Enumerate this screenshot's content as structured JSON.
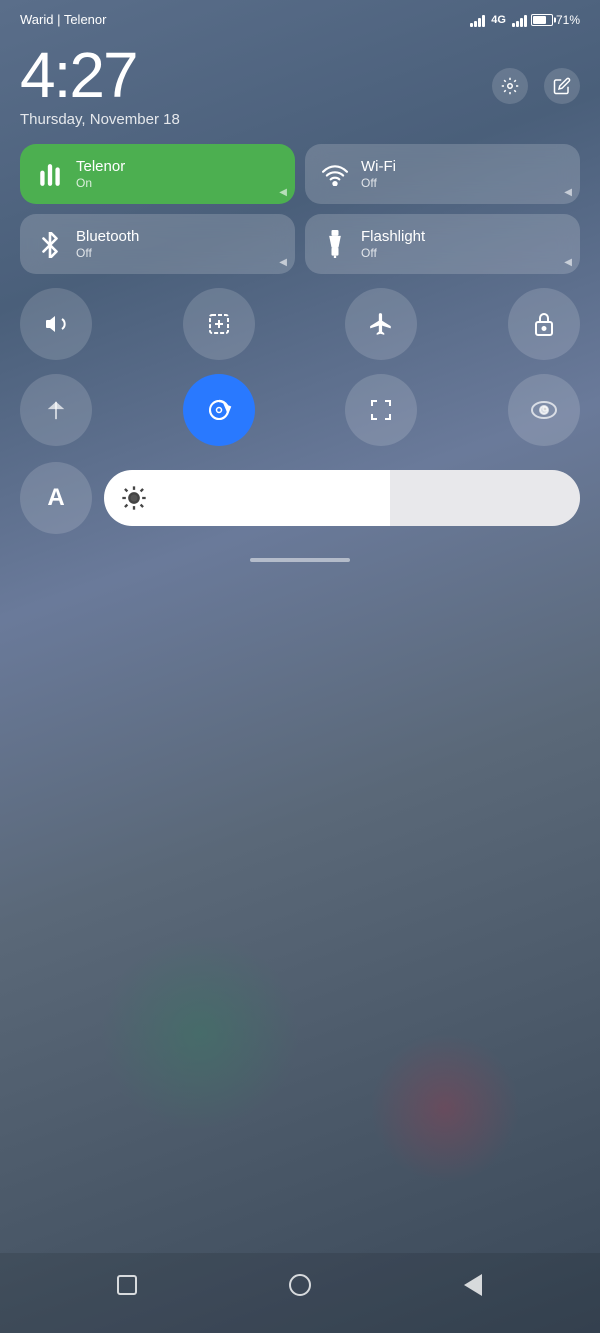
{
  "status_bar": {
    "carrier": "Warid | Telenor",
    "network": "4G",
    "battery_percent": "71%"
  },
  "clock": {
    "time": "4:27",
    "date": "Thursday, November 18"
  },
  "tiles": [
    {
      "id": "telenor",
      "name": "Telenor",
      "status": "On",
      "active": true,
      "icon": "signal"
    },
    {
      "id": "wifi",
      "name": "Wi-Fi",
      "status": "Off",
      "active": false,
      "icon": "wifi"
    },
    {
      "id": "bluetooth",
      "name": "Bluetooth",
      "status": "Off",
      "active": false,
      "icon": "bluetooth"
    },
    {
      "id": "flashlight",
      "name": "Flashlight",
      "status": "Off",
      "active": false,
      "icon": "flashlight"
    }
  ],
  "icon_circles_row1": [
    {
      "id": "bell",
      "label": "Sound",
      "icon": "🔔",
      "active": false
    },
    {
      "id": "screenshot",
      "label": "Screenshot",
      "icon": "✂",
      "active": false
    },
    {
      "id": "airplane",
      "label": "Airplane Mode",
      "icon": "✈",
      "active": false
    },
    {
      "id": "lock",
      "label": "Lock",
      "icon": "🔒",
      "active": false
    }
  ],
  "icon_circles_row2": [
    {
      "id": "location",
      "label": "Location",
      "icon": "▶",
      "active": false
    },
    {
      "id": "autorotate",
      "label": "Auto Rotate",
      "icon": "↻",
      "active": true
    },
    {
      "id": "scan",
      "label": "Scan",
      "icon": "▢",
      "active": false
    },
    {
      "id": "eye",
      "label": "Eye Comfort",
      "icon": "👁",
      "active": false
    }
  ],
  "font_size": {
    "label": "A"
  },
  "brightness": {
    "level": 60,
    "icon": "☀"
  },
  "nav": {
    "back_label": "Back",
    "home_label": "Home",
    "recent_label": "Recent"
  }
}
